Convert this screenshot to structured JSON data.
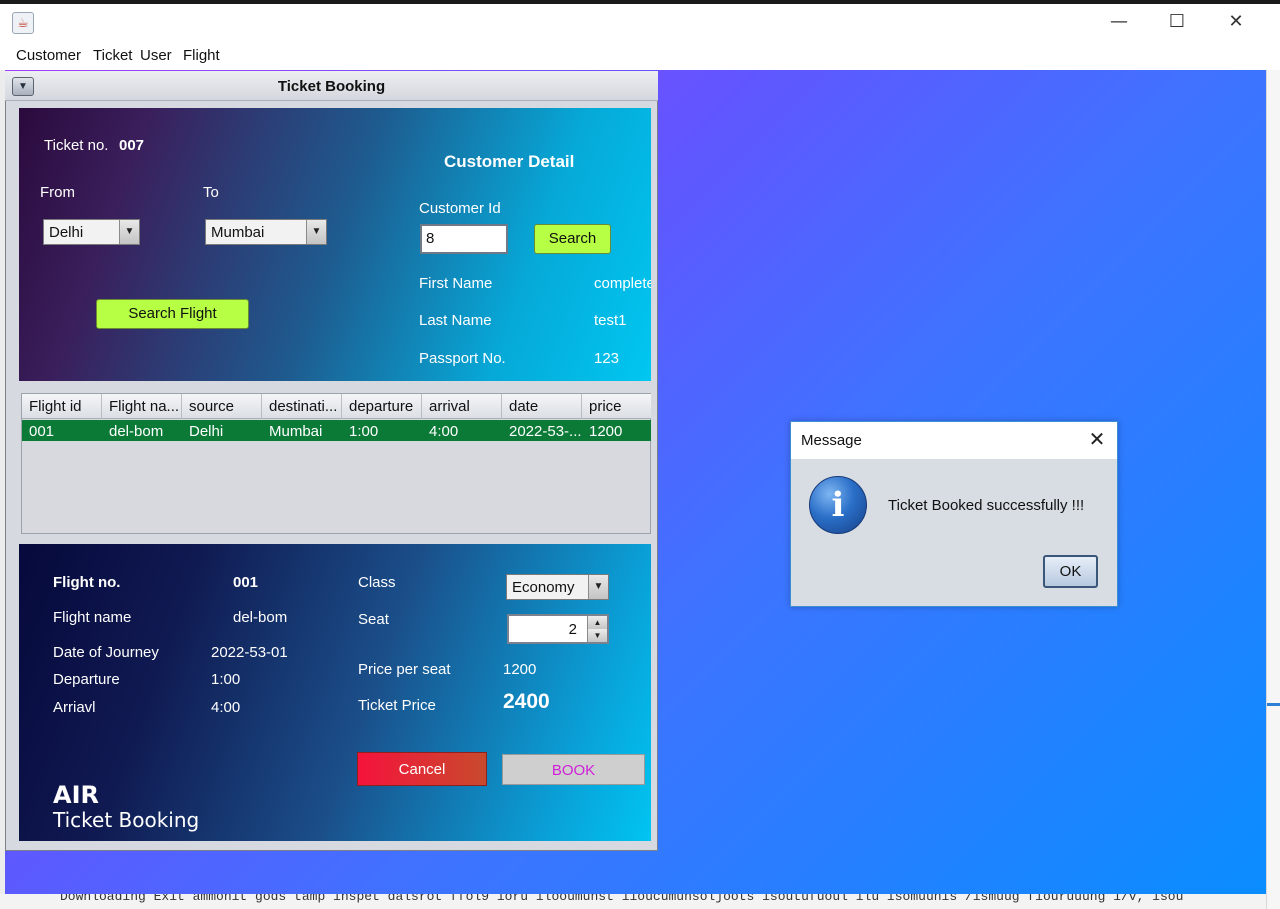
{
  "window": {
    "minimize_glyph": "—",
    "maximize_glyph": "☐",
    "close_glyph": "✕",
    "app_icon": "java-icon"
  },
  "menubar": {
    "items": [
      "Customer",
      "Ticket",
      "User",
      "Flight"
    ]
  },
  "frame": {
    "title": "Ticket Booking",
    "menu_icon": "▼"
  },
  "ticket": {
    "label": "Ticket no.",
    "number": "007"
  },
  "route": {
    "from_label": "From",
    "to_label": "To",
    "from_value": "Delhi",
    "to_value": "Mumbai",
    "search_flight_label": "Search Flight"
  },
  "customer": {
    "heading": "Customer Detail",
    "id_label": "Customer Id",
    "id_value": "8",
    "search_label": "Search",
    "first_name_label": "First Name",
    "first_name_value": "complete",
    "last_name_label": "Last Name",
    "last_name_value": "test1",
    "passport_label": "Passport No.",
    "passport_value": "123"
  },
  "flights_table": {
    "headers": [
      "Flight id",
      "Flight na...",
      "source",
      "destinati...",
      "departure",
      "arrival",
      "date",
      "price"
    ],
    "rows": [
      [
        "001",
        "del-bom",
        "Delhi",
        "Mumbai",
        "1:00",
        "4:00",
        "2022-53-...",
        "1200"
      ]
    ]
  },
  "flight_detail": {
    "flight_no_label": "Flight no.",
    "flight_no_value": "001",
    "flight_name_label": "Flight name",
    "flight_name_value": "del-bom",
    "date_label": "Date of Journey",
    "date_value": "2022-53-01",
    "departure_label": "Departure",
    "departure_value": "1:00",
    "arrival_label": "Arriavl",
    "arrival_value": "4:00",
    "class_label": "Class",
    "class_value": "Economy",
    "seat_label": "Seat",
    "seat_value": "2",
    "price_per_seat_label": "Price per seat",
    "price_per_seat_value": "1200",
    "ticket_price_label": "Ticket Price",
    "ticket_price_value": "2400",
    "cancel_label": "Cancel",
    "book_label": "BOOK",
    "brand_line1": "AIR",
    "brand_line2": "Ticket Booking"
  },
  "dialog": {
    "title": "Message",
    "message": "Ticket Booked successfully !!!",
    "ok_label": "OK",
    "icon": "info-icon",
    "icon_glyph": "i",
    "close_glyph": "✕"
  },
  "background": {
    "console_text": "Downloading Exit ammonit gods tamp inspet dalsrot ffol9 ioru ilooumunst iioucumunsoljoots isoutufuoul ilu isomuunis /ismuug fiouruuung 1/v, isou"
  },
  "colors": {
    "desktop_gradient_start": "#a040ff",
    "desktop_gradient_end": "#0a8dff",
    "search_button": "#b6ff45",
    "table_selected_row": "#0b7a37",
    "cancel_button": "#f5133c",
    "book_text": "#d020d8"
  }
}
